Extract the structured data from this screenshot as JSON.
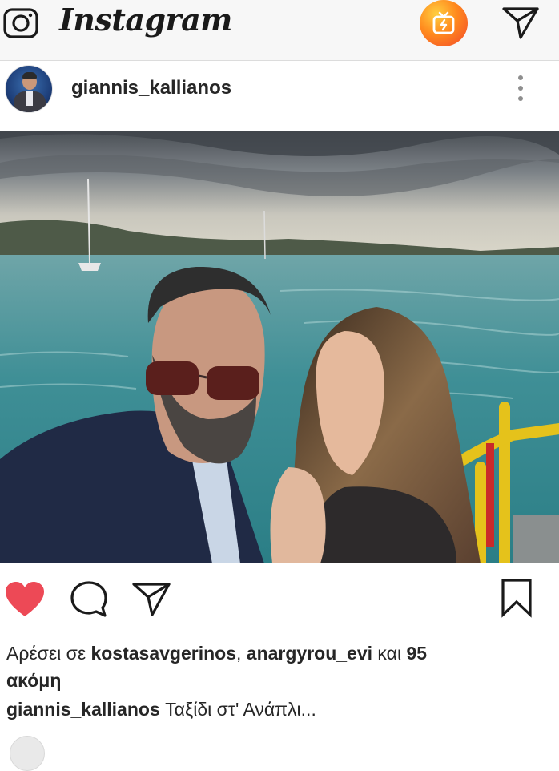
{
  "topbar": {
    "logo_text": "Instagram",
    "camera_icon": "camera-icon",
    "igtv_icon": "igtv-icon",
    "direct_icon": "paper-plane-icon",
    "igtv_gradient": [
      "#ffcf40",
      "#ff8a1e",
      "#f2462b"
    ]
  },
  "post": {
    "username": "giannis_kallianos",
    "more_icon": "more-vertical-icon",
    "photo_icon": "post-photo",
    "actions": {
      "like_icon": "heart-icon",
      "liked": true,
      "like_color": "#ed4956",
      "comment_icon": "comment-icon",
      "share_icon": "paper-plane-icon",
      "save_icon": "bookmark-icon"
    },
    "likes": {
      "prefix": "Αρέσει σε ",
      "user1": "kostasavgerinos",
      "separator": ", ",
      "user2": "anargyrou_evi",
      "conjunction": " και ",
      "count": "95",
      "suffix": "ακόμη"
    },
    "caption": {
      "username": "giannis_kallianos",
      "text": " Ταξίδι στ' Ανάπλι..."
    }
  }
}
